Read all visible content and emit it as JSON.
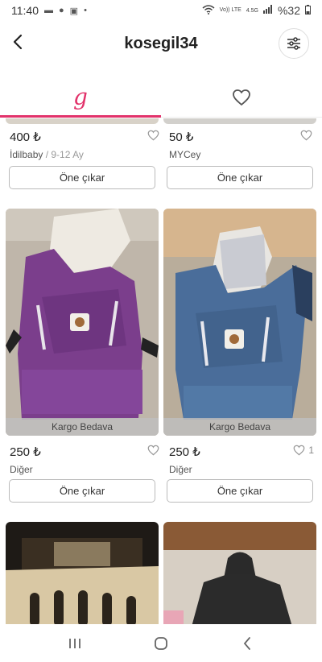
{
  "status": {
    "time": "11:40",
    "network": "Vo)) LTE",
    "network_gen": "4.5G",
    "battery": "%32"
  },
  "header": {
    "title": "kosegil34"
  },
  "tabs": [
    {
      "name": "listings",
      "logo": "g",
      "active": true
    },
    {
      "name": "likes",
      "icon": "heart-outline-icon",
      "active": false
    }
  ],
  "partial_strips": [
    "Kargo Bedava",
    "Kargo Bedava"
  ],
  "products": [
    {
      "price": "400 ₺",
      "seller": "İdilbaby",
      "size": "/ 9-12 Ay",
      "likes": "",
      "cargo": "",
      "button": "Öne çıkar"
    },
    {
      "price": "50 ₺",
      "seller": "MYCey",
      "size": "",
      "likes": "",
      "cargo": "",
      "button": "Öne çıkar"
    },
    {
      "price": "250 ₺",
      "seller": "Diğer",
      "size": "",
      "likes": "",
      "cargo": "Kargo Bedava",
      "button": "Öne çıkar"
    },
    {
      "price": "250 ₺",
      "seller": "Diğer",
      "size": "",
      "likes": "1",
      "cargo": "Kargo Bedava",
      "button": "Öne çıkar"
    }
  ],
  "colors": {
    "brand": "#e2336b",
    "purple_carrier": "#7b3e8c",
    "blue_carrier": "#4a6d9a"
  }
}
